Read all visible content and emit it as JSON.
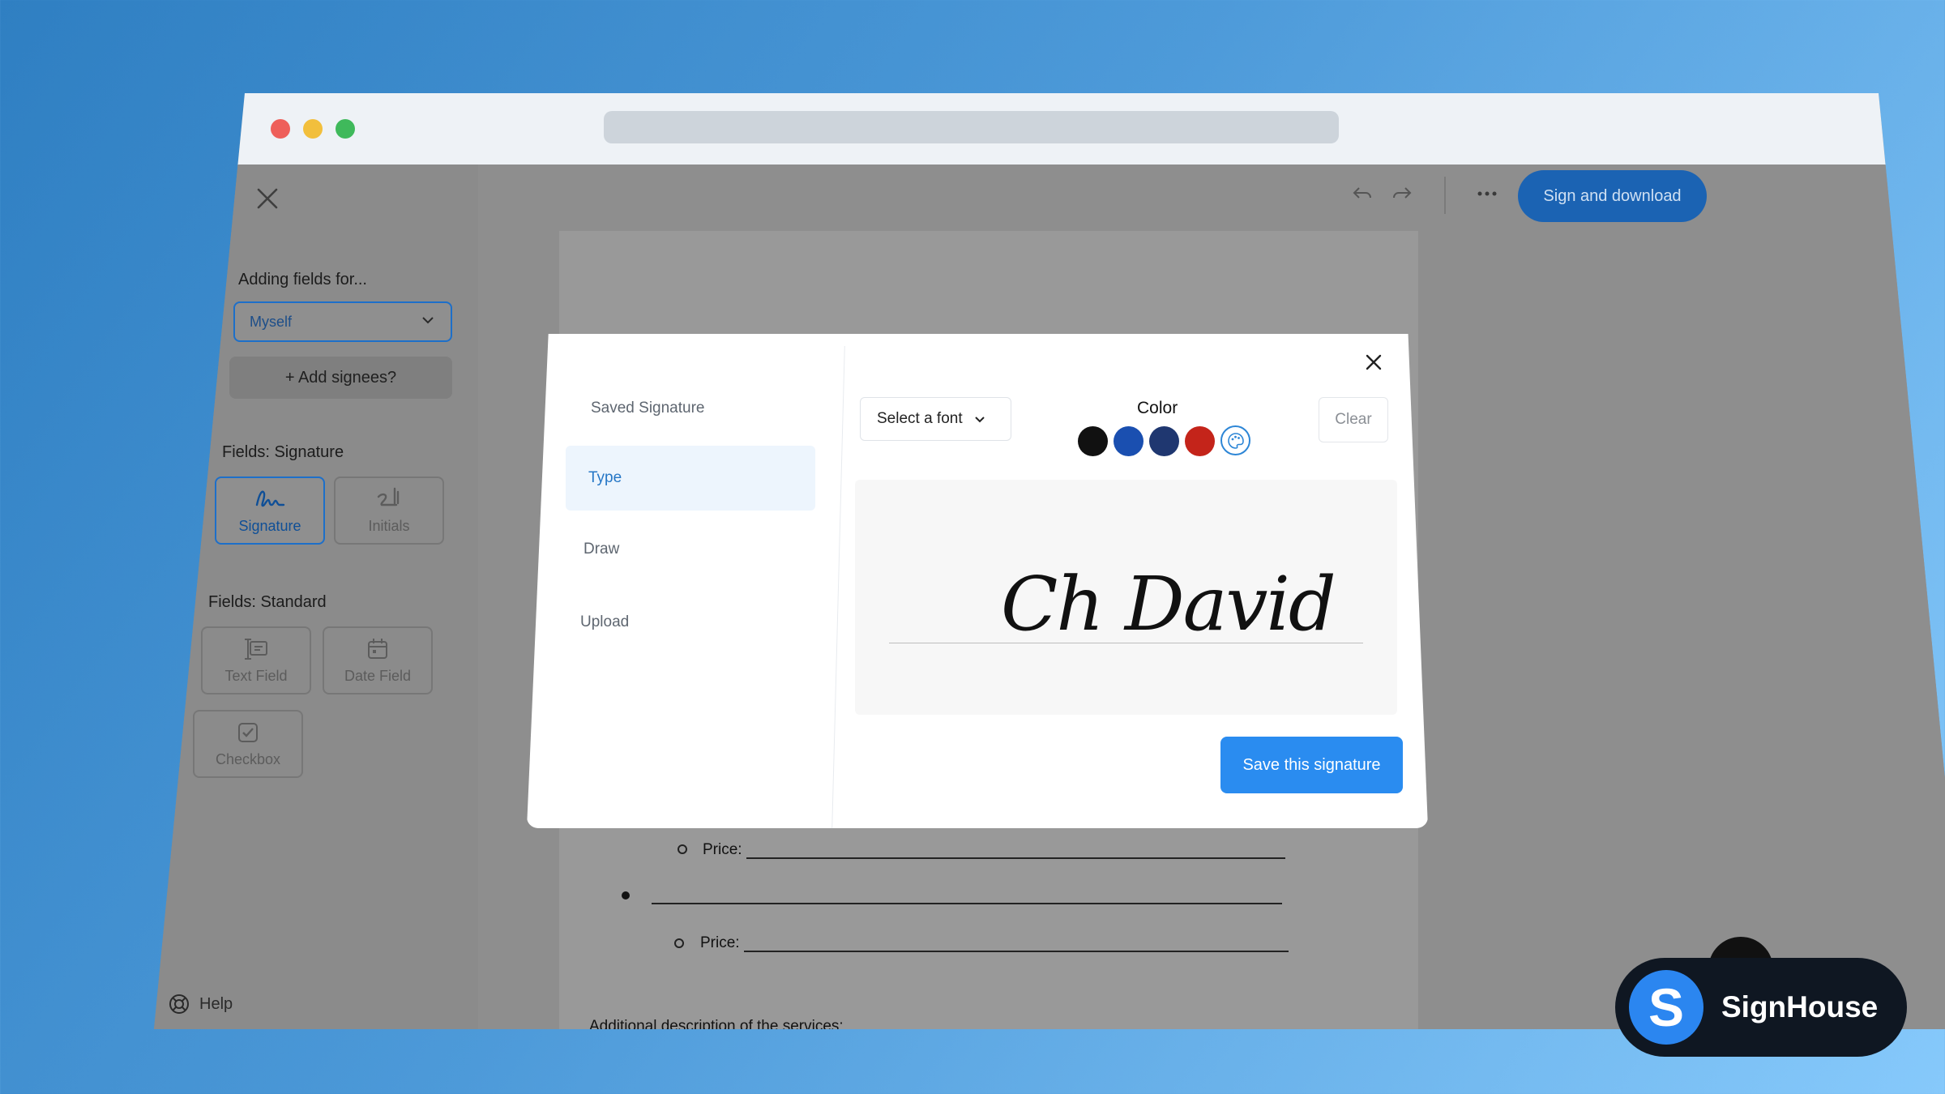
{
  "toolbar": {
    "sign_download_label": "Sign and download",
    "undo_icon": "undo-icon",
    "redo_icon": "redo-icon",
    "more_icon": "more-icon"
  },
  "sidebar": {
    "adding_for_label": "Adding fields for...",
    "assignee_value": "Myself",
    "add_signees_label": "+ Add signees?",
    "signature_section_title": "Fields: Signature",
    "signature_fields": [
      {
        "label": "Signature",
        "icon": "signature-icon"
      },
      {
        "label": "Initials",
        "icon": "initials-icon"
      }
    ],
    "standard_section_title": "Fields: Standard",
    "standard_fields": [
      {
        "label": "Text Field",
        "icon": "text-field-icon"
      },
      {
        "label": "Date Field",
        "icon": "calendar-icon"
      },
      {
        "label": "Checkbox",
        "icon": "checkbox-icon"
      }
    ],
    "help_label": "Help"
  },
  "document": {
    "price_label": "Price:",
    "additional_desc": "Additional description of the services:"
  },
  "modal": {
    "tabs": [
      "Saved Signature",
      "Type",
      "Draw",
      "Upload"
    ],
    "active_tab": "Type",
    "font_select_label": "Select a font",
    "color_label": "Color",
    "colors": [
      "#111111",
      "#1a4fb0",
      "#1f3770",
      "#c4241a"
    ],
    "clear_label": "Clear",
    "signature_text": "Ch David",
    "save_label": "Save this signature"
  },
  "brand": {
    "logo_letter": "S",
    "name": "SignHouse"
  }
}
